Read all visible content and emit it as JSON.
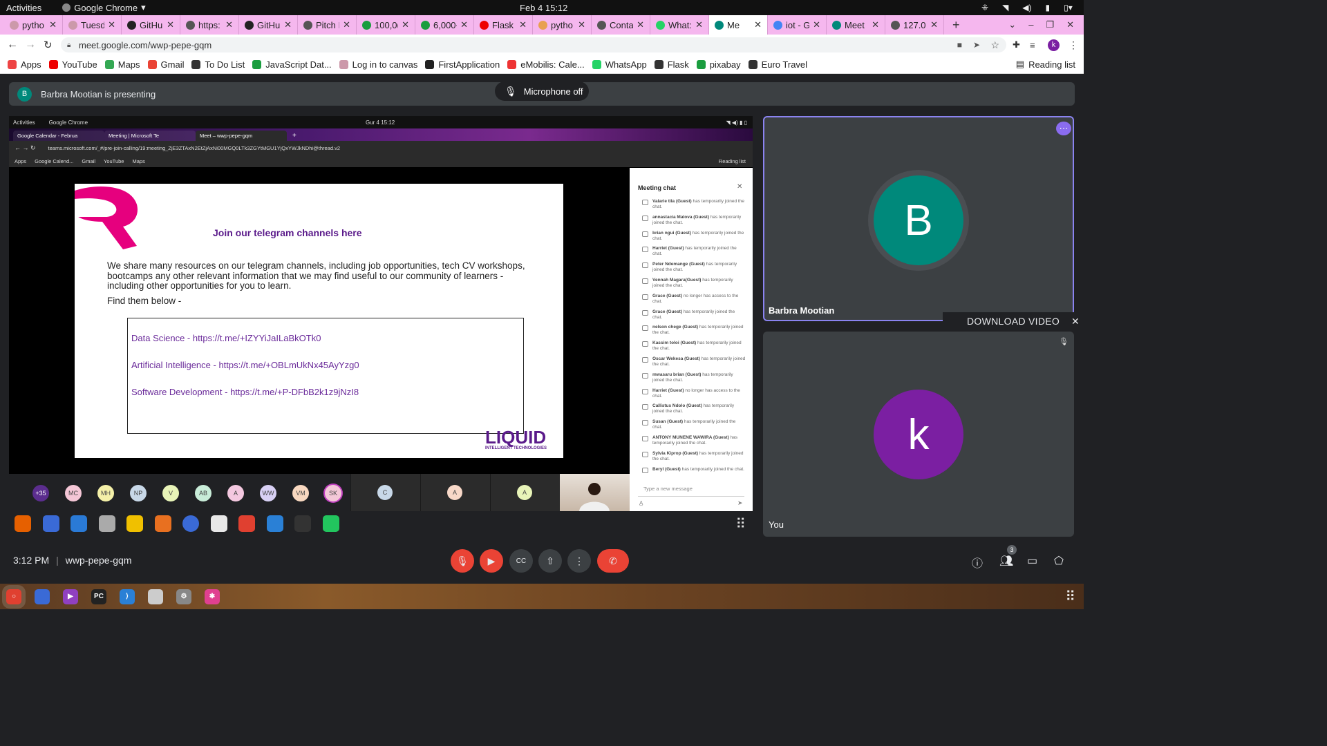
{
  "os_topbar": {
    "activities": "Activities",
    "app": "Google Chrome",
    "datetime": "Feb 4  15:12"
  },
  "tabs": [
    {
      "label": "pytho",
      "color": "#c9a"
    },
    {
      "label": "Tuesd",
      "color": "#c9a"
    },
    {
      "label": "GitHu",
      "color": "#222"
    },
    {
      "label": "https:",
      "color": "#555"
    },
    {
      "label": "GitHu",
      "color": "#222"
    },
    {
      "label": "Pitch I",
      "color": "#555"
    },
    {
      "label": "100,0(",
      "color": "#1a9d3f"
    },
    {
      "label": "6,000+",
      "color": "#1a9d3f"
    },
    {
      "label": "Flask I",
      "color": "#e00"
    },
    {
      "label": "pytho",
      "color": "#e8a050"
    },
    {
      "label": "Conta",
      "color": "#555"
    },
    {
      "label": "What:",
      "color": "#25d366"
    },
    {
      "label": "Me",
      "color": "#00897b"
    },
    {
      "label": "iot - G",
      "color": "#4285f4"
    },
    {
      "label": "Meet",
      "color": "#00897b"
    },
    {
      "label": "127.0",
      "color": "#555"
    }
  ],
  "address": {
    "url": "meet.google.com/wwp-pepe-gqm",
    "profile_initial": "k"
  },
  "bookmarks": [
    {
      "label": "Apps",
      "color": "#e44"
    },
    {
      "label": "YouTube",
      "color": "#e00"
    },
    {
      "label": "Maps",
      "color": "#34a853"
    },
    {
      "label": "Gmail",
      "color": "#ea4335"
    },
    {
      "label": "To Do List",
      "color": "#333"
    },
    {
      "label": "JavaScript Dat...",
      "color": "#1a9d3f"
    },
    {
      "label": "Log in to canvas",
      "color": "#c9a"
    },
    {
      "label": "FirstApplication",
      "color": "#222"
    },
    {
      "label": "eMobilis: Cale...",
      "color": "#e33"
    },
    {
      "label": "WhatsApp",
      "color": "#25d366"
    },
    {
      "label": "Flask",
      "color": "#333"
    },
    {
      "label": "pixabay",
      "color": "#1a9d3f"
    },
    {
      "label": "Euro Travel",
      "color": "#333"
    }
  ],
  "reading_list": "Reading list",
  "presenting": {
    "initial": "B",
    "text": "Barbra Mootian is presenting"
  },
  "mic_toast": "Microphone off",
  "inner": {
    "activities": "Activities",
    "app": "Google Chrome",
    "datetime": "Gur 4  15:12",
    "tabs": [
      "Google Calendar - Februa",
      "Meeting | Microsoft Te",
      "Meet – wwp-pepe-gqm"
    ],
    "url": "teams.microsoft.com/_#/pre-join-calling/19:meeting_ZjE3ZTAxN2EtZjAxNi00MGQ0LTk3ZGYtMGU1YjQxYWJkNDhi@thread.v2",
    "bookmarks": [
      "Apps",
      "Google Calend...",
      "Gmail",
      "YouTube",
      "Maps"
    ],
    "reading_list": "Reading list"
  },
  "slide": {
    "heading": "Join our telegram channels here",
    "paragraph": "We share many resources on our telegram channels, including job opportunities, tech CV workshops, bootcamps any other relevant information that we may find useful to our community of learners - including other opportunities for you to learn.",
    "find": "Find them below -",
    "links": [
      "Data Science - https://t.me/+IZYYiJaILaBkOTk0",
      "Artificial Intelligence - https://t.me/+OBLmUkNx45AyYzg0",
      "Software Development - https://t.me/+P-DFbB2k1z9jNzI8"
    ],
    "logo": "LIQUID",
    "logo_sub": "INTELLIGENT TECHNOLOGIES"
  },
  "chat": {
    "title": "Meeting chat",
    "items": [
      {
        "name": "Valarie tila (Guest)",
        "msg": "has temporarily joined the chat."
      },
      {
        "name": "annastacia Malova (Guest)",
        "msg": "has temporarily joined the chat."
      },
      {
        "name": "brian ngui (Guest)",
        "msg": "has temporarily joined the chat."
      },
      {
        "name": "Harriet (Guest)",
        "msg": "has temporarily joined the chat."
      },
      {
        "name": "Peter Ndemange (Guest)",
        "msg": "has temporarily joined the chat."
      },
      {
        "name": "Vennah Magara(Guest)",
        "msg": "has temporarily joined the chat."
      },
      {
        "name": "Grace (Guest)",
        "msg": "no longer has access to the chat."
      },
      {
        "name": "Grace (Guest)",
        "msg": "has temporarily joined the chat."
      },
      {
        "name": "nelson chege (Guest)",
        "msg": "has temporarily joined the chat."
      },
      {
        "name": "Kassim toloi (Guest)",
        "msg": "has temporarily joined the chat."
      },
      {
        "name": "Oscar Wekesa (Guest)",
        "msg": "has temporarily joined the chat."
      },
      {
        "name": "mwasaru brian (Guest)",
        "msg": "has temporarily joined the chat."
      },
      {
        "name": "Harriet (Guest)",
        "msg": "no longer has access to the chat."
      },
      {
        "name": "Callistus Ndolo (Guest)",
        "msg": "has temporarily joined the chat."
      },
      {
        "name": "Susan (Guest)",
        "msg": "has temporarily joined the chat."
      },
      {
        "name": "ANTONY MUNENE WAWIRA (Guest)",
        "msg": "has temporarily joined the chat."
      },
      {
        "name": "Sylvia Kiprop (Guest)",
        "msg": "has temporarily joined the chat."
      },
      {
        "name": "Beryl (Guest)",
        "msg": "has temporarily joined the chat."
      }
    ],
    "input_placeholder": "Type a new message"
  },
  "participants": [
    {
      "initials": "+35",
      "color": "#5b2d8e",
      "text_color": "#fff"
    },
    {
      "initials": "MC",
      "color": "#f4c6d6",
      "text_color": "#444"
    },
    {
      "initials": "MH",
      "color": "#f4f0a8",
      "text_color": "#444"
    },
    {
      "initials": "NP",
      "color": "#c8d8e8",
      "text_color": "#444"
    },
    {
      "initials": "V",
      "color": "#e8f4b8",
      "text_color": "#444"
    },
    {
      "initials": "AB",
      "color": "#c8ecd8",
      "text_color": "#444"
    },
    {
      "initials": "A",
      "color": "#f4c8e0",
      "text_color": "#444"
    },
    {
      "initials": "WW",
      "color": "#d8d0f4",
      "text_color": "#444"
    },
    {
      "initials": "VM",
      "color": "#f8d8c0",
      "text_color": "#444"
    },
    {
      "initials": "SK",
      "color": "#f4c8d8",
      "text_color": "#444"
    }
  ],
  "participant_tiles": [
    {
      "initials": "C",
      "color": "#c8d8e8"
    },
    {
      "initials": "A",
      "color": "#f8d8c8"
    },
    {
      "initials": "A",
      "color": "#e8f4b8"
    }
  ],
  "tile_presenter": {
    "initial": "B",
    "name": "Barbra Mootian",
    "color": "#00897b"
  },
  "tile_you": {
    "initial": "k",
    "name": "You",
    "color": "#7b1fa2"
  },
  "download_video": "DOWNLOAD VIDEO",
  "meeting": {
    "time": "3:12 PM",
    "code": "wwp-pepe-gqm",
    "people_count": "3"
  }
}
